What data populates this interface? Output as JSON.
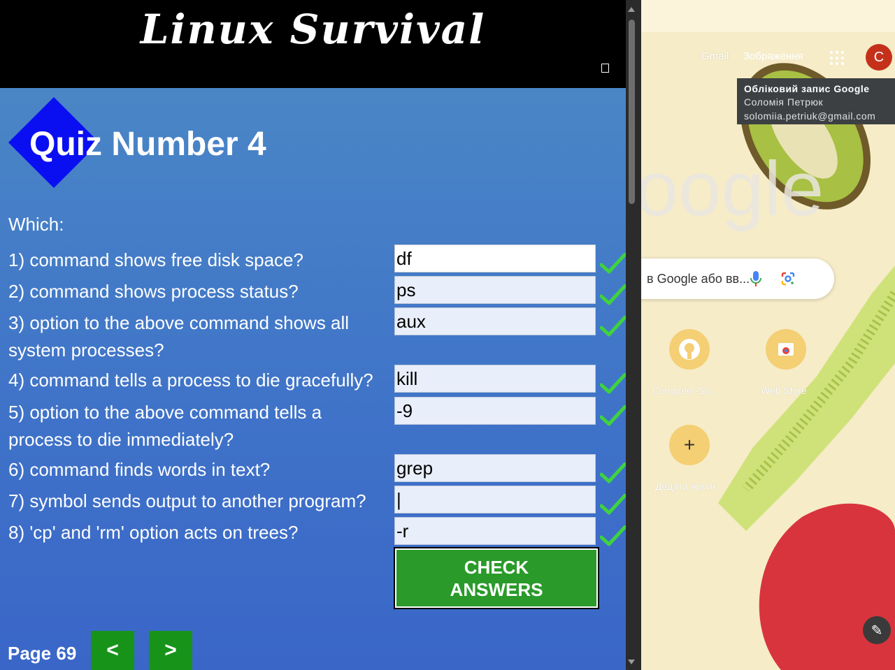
{
  "quiz": {
    "banner_title": "Linux Survival",
    "title": "Quiz Number 4",
    "intro": "Which:",
    "questions": [
      {
        "text": "1) command shows free disk space?",
        "answer": "df"
      },
      {
        "text": "2) command shows process status?",
        "answer": "ps"
      },
      {
        "text": "3) option to the above command shows all system processes?",
        "answer": "aux"
      },
      {
        "text": "4) command tells a process to die gracefully?",
        "answer": "kill"
      },
      {
        "text": "5) option to the above command tells a process to die immediately?",
        "answer": "-9"
      },
      {
        "text": "6) command finds words in text?",
        "answer": "grep"
      },
      {
        "text": "7) symbol sends output to another program?",
        "answer": "|"
      },
      {
        "text": "8) 'cp' and 'rm' option acts on trees?",
        "answer": "-r"
      }
    ],
    "check_button": "CHECK ANSWERS",
    "page_label": "Page 69",
    "prev_label": "<",
    "next_label": ">",
    "tick_color": "#3fd23f"
  },
  "browser": {
    "gmail_link": "Gmail",
    "images_link": "Зображення",
    "avatar_letter": "C",
    "account_tooltip": {
      "title": "Обліковий запис Google",
      "name": "Соломія Петрюк",
      "email": "solomiia.petriuk@gmail.com"
    },
    "logo_fragment": "oogle",
    "search_placeholder": "в Google або вв...",
    "shortcuts": [
      {
        "label": "Computer-Sc...",
        "icon": "github-icon"
      },
      {
        "label": "Web Store",
        "icon": "chrome-web-store-icon"
      },
      {
        "label": "Додати ярлик",
        "icon": "plus-icon"
      }
    ]
  }
}
